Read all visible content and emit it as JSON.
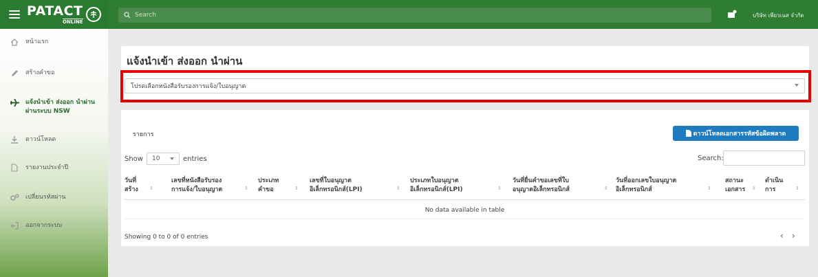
{
  "header": {
    "logo_main": "PATACT",
    "logo_sub": "ONLINE",
    "search_placeholder": "Search",
    "company_name": "บริษัท เพียวเนส จำกัด"
  },
  "sidebar": {
    "items": [
      {
        "label": "หน้าแรก",
        "icon": "home-icon"
      },
      {
        "label": "สร้างคำขอ",
        "icon": "pencil-icon"
      },
      {
        "label": "แจ้งนำเข้า ส่งออก นำผ่าน ผ่านระบบ NSW",
        "icon": "airplane-icon",
        "active": true
      },
      {
        "label": "ดาวน์โหลด",
        "icon": "download-icon"
      },
      {
        "label": "รายงานประจำปี",
        "icon": "document-icon"
      },
      {
        "label": "เปลี่ยนรหัสผ่าน",
        "icon": "gears-icon"
      },
      {
        "label": "ออกจากระบบ",
        "icon": "logout-icon"
      }
    ]
  },
  "page": {
    "title": "แจ้งนำเข้า ส่งออก นำผ่าน",
    "select_placeholder": "โปรดเลือกหนังสือรับรองการแจ้ง/ใบอนุญาต"
  },
  "list": {
    "title": "รายการ",
    "download_button": "ดาวน์โหลดเอกสารรหัสข้อผิดพลาด",
    "show_label": "Show",
    "entries_value": "10",
    "entries_label": "entries",
    "search_label": "Search:",
    "columns": [
      {
        "l1": "วันที่",
        "l2": "สร้าง"
      },
      {
        "l1": "เลขที่หนังสือรับรอง",
        "l2": "การแจ้ง/ใบอนุญาต"
      },
      {
        "l1": "ประเภท",
        "l2": "คำขอ"
      },
      {
        "l1": "เลขที่ใบอนุญาต",
        "l2": "อิเล็กทรอนิกส์(LPI)"
      },
      {
        "l1": "ประเภทใบอนุญาต",
        "l2": "อิเล็กทรอนิกส์(LPI)"
      },
      {
        "l1": "วันที่ยื่นคำขอเลขที่ใบ",
        "l2": "อนุญาตอิเล็กทรอนิกส์"
      },
      {
        "l1": "วันที่ออกเลขใบอนุญาต",
        "l2": "อิเล็กทรอนิกส์"
      },
      {
        "l1": "สถานะ",
        "l2": "เอกสาร"
      },
      {
        "l1": "ดำเนิน",
        "l2": "การ"
      }
    ],
    "empty_text": "No data available in table",
    "info_text": "Showing 0 to 0 of 0 entries",
    "prev_glyph": "‹",
    "next_glyph": "›"
  },
  "colors": {
    "header_green": "#2e7d32",
    "highlight_red": "#e60000",
    "button_blue": "#1f7bbf"
  }
}
